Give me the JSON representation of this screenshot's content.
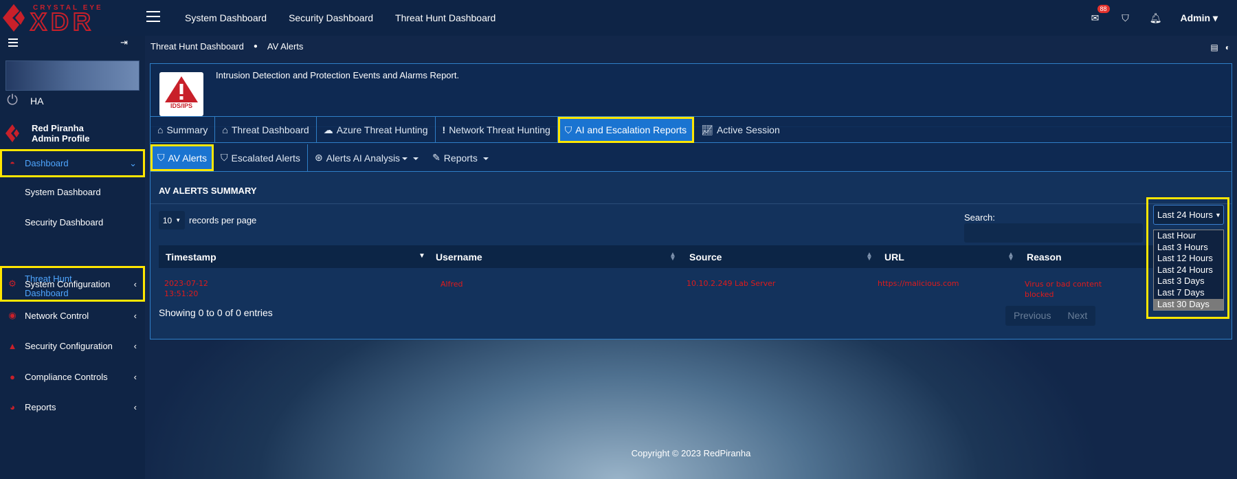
{
  "brand": {
    "name": "CRYSTAL EYE",
    "product": "XDR",
    "accent": "#c8202a"
  },
  "topnav": [
    "System Dashboard",
    "Security Dashboard",
    "Threat Hunt Dashboard"
  ],
  "topright": {
    "mail_count": "88",
    "user": "Admin"
  },
  "sidebar": {
    "ha_label": "HA",
    "profile_name": "Red Piranha",
    "profile_role": "Admin Profile",
    "dashboard": "Dashboard",
    "sub": [
      "System Dashboard",
      "Security Dashboard",
      "Threat Hunt",
      "Dashboard"
    ],
    "menu": [
      "System Configuration",
      "Network Control",
      "Security Configuration",
      "Compliance Controls",
      "Reports"
    ]
  },
  "breadcrumb": [
    "Threat Hunt Dashboard",
    "AV Alerts"
  ],
  "info": {
    "badge": "IDS/IPS",
    "text": "Intrusion Detection and Protection Events and Alarms Report."
  },
  "tabs": [
    "Summary",
    "Threat Dashboard",
    "Azure Threat Hunting",
    "Network Threat Hunting",
    "AI and Escalation Reports",
    "Active Session"
  ],
  "subtabs": [
    "AV Alerts",
    "Escalated Alerts",
    "Alerts AI Analysis",
    "Reports"
  ],
  "summary": {
    "title": "AV ALERTS SUMMARY",
    "records_value": "10",
    "records_label": "records per page",
    "search_label": "Search:"
  },
  "table": {
    "headers": [
      "Timestamp",
      "Username",
      "Source",
      "URL",
      "Reason"
    ],
    "row": {
      "timestamp_date": "2023-07-12",
      "timestamp_time": "13:51:20",
      "username": "Alfred",
      "source": "10.10.2.249 Lab Server",
      "url": "https://malicious.com",
      "reason_1": "Virus or bad content",
      "reason_2": "blocked"
    },
    "showing": "Showing 0 to 0 of 0 entries",
    "prev": "Previous",
    "next": "Next"
  },
  "range": {
    "selected": "Last 24 Hours",
    "options": [
      "Last Hour",
      "Last 3 Hours",
      "Last 12 Hours",
      "Last 24 Hours",
      "Last 3 Days",
      "Last 7 Days",
      "Last 30 Days"
    ]
  },
  "footer": "Copyright © 2023 RedPiranha"
}
